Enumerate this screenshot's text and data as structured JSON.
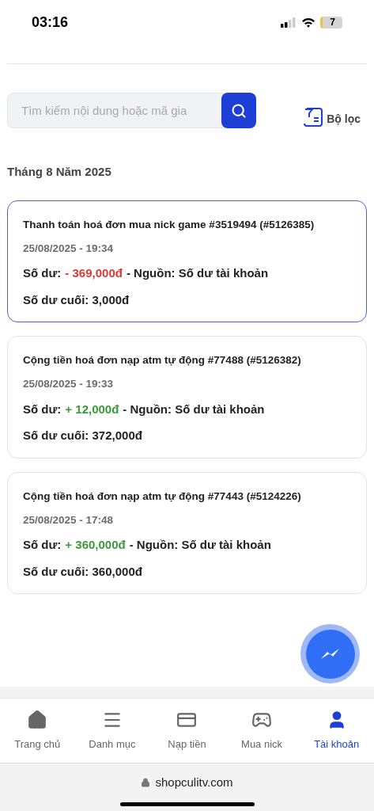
{
  "status_bar": {
    "time": "03:16",
    "battery": "7"
  },
  "search": {
    "placeholder": "Tìm kiếm nội dung hoặc mã gia"
  },
  "filter": {
    "label": "Bộ lọc"
  },
  "month_heading": "Tháng 8 Năm 2025",
  "transactions": [
    {
      "title": "Thanh toán hoá đơn mua nick game #3519494 (#5126385)",
      "datetime": "25/08/2025 - 19:34",
      "balance_label": "Số dư:",
      "amount": "- 369,000đ",
      "kind": "debit",
      "source": "- Nguồn: Số dư tài khoản",
      "final_balance": "Số dư cuối: 3,000đ",
      "selected": true
    },
    {
      "title": "Cộng tiền hoá đơn nạp atm tự động #77488 (#5126382)",
      "datetime": "25/08/2025 - 19:33",
      "balance_label": "Số dư:",
      "amount": "+ 12,000đ",
      "kind": "credit",
      "source": "- Nguồn: Số dư tài khoản",
      "final_balance": "Số dư cuối: 372,000đ",
      "selected": false
    },
    {
      "title": "Cộng tiền hoá đơn nạp atm tự động #77443 (#5124226)",
      "datetime": "25/08/2025 - 17:48",
      "balance_label": "Số dư:",
      "amount": "+ 360,000đ",
      "kind": "credit",
      "source": "- Nguồn: Số dư tài khoản",
      "final_balance": "Số dư cuối: 360,000đ",
      "selected": false
    }
  ],
  "bottom_nav": [
    {
      "label": "Trang chủ",
      "kind": "home",
      "selected": false
    },
    {
      "label": "Danh mục",
      "kind": "menu",
      "selected": false
    },
    {
      "label": "Nạp tiền",
      "kind": "card",
      "selected": false
    },
    {
      "label": "Mua nick",
      "kind": "gamepad",
      "selected": false
    },
    {
      "label": "Tài khoản",
      "kind": "user",
      "selected": true
    }
  ],
  "url": "shopculitv.com"
}
